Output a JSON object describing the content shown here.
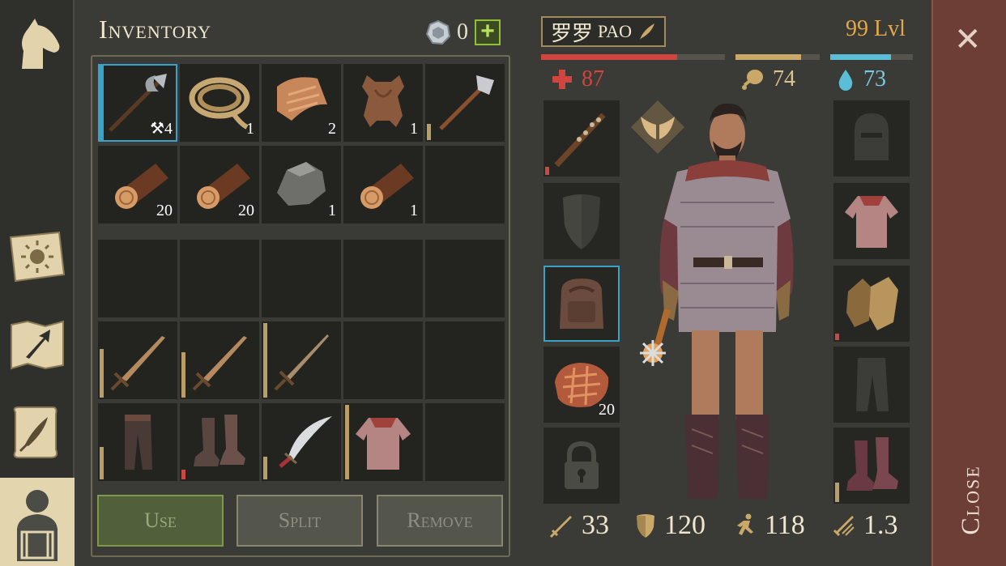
{
  "sidebar": {
    "items": [
      {
        "name": "horse",
        "icon": "horse-head-icon"
      },
      {
        "name": "skills",
        "icon": "sun-book-icon"
      },
      {
        "name": "map",
        "icon": "map-arrow-icon"
      },
      {
        "name": "quests",
        "icon": "scroll-quill-icon"
      },
      {
        "name": "inventory",
        "icon": "character-backpack-icon",
        "active": true
      }
    ]
  },
  "inventory": {
    "title": "Inventory",
    "coins": "0",
    "add_label": "+",
    "slots": [
      {
        "item": "halberd",
        "qty": "4",
        "selected": true
      },
      {
        "item": "rope",
        "qty": "1"
      },
      {
        "item": "cloth",
        "qty": "2"
      },
      {
        "item": "leather-hide",
        "qty": "1"
      },
      {
        "item": "hammer",
        "qty": ""
      },
      {
        "item": "log",
        "qty": "20"
      },
      {
        "item": "log",
        "qty": "20"
      },
      {
        "item": "stone",
        "qty": "1"
      },
      {
        "item": "log",
        "qty": "1"
      }
    ],
    "buttons": {
      "use": "Use",
      "split": "Split",
      "remove": "Remove"
    }
  },
  "character": {
    "name_cn": "罗罗",
    "name_latin": "PAO",
    "level": "99 Lvl",
    "health": "87",
    "hunger": "74",
    "thirst": "73",
    "health_fill": 0.74,
    "hunger_fill": 0.78,
    "thirst_fill": 0.74,
    "backpack_qty": "",
    "meat_qty": "20",
    "attack": "33",
    "defense": "120",
    "speed": "118",
    "attack_speed": "1.3"
  },
  "close": {
    "label": "Close"
  },
  "colors": {
    "accent_blue": "#3aa1c9",
    "health_red": "#d0453f",
    "level_orange": "#e3a84b",
    "thirst_blue": "#5bbed6"
  }
}
